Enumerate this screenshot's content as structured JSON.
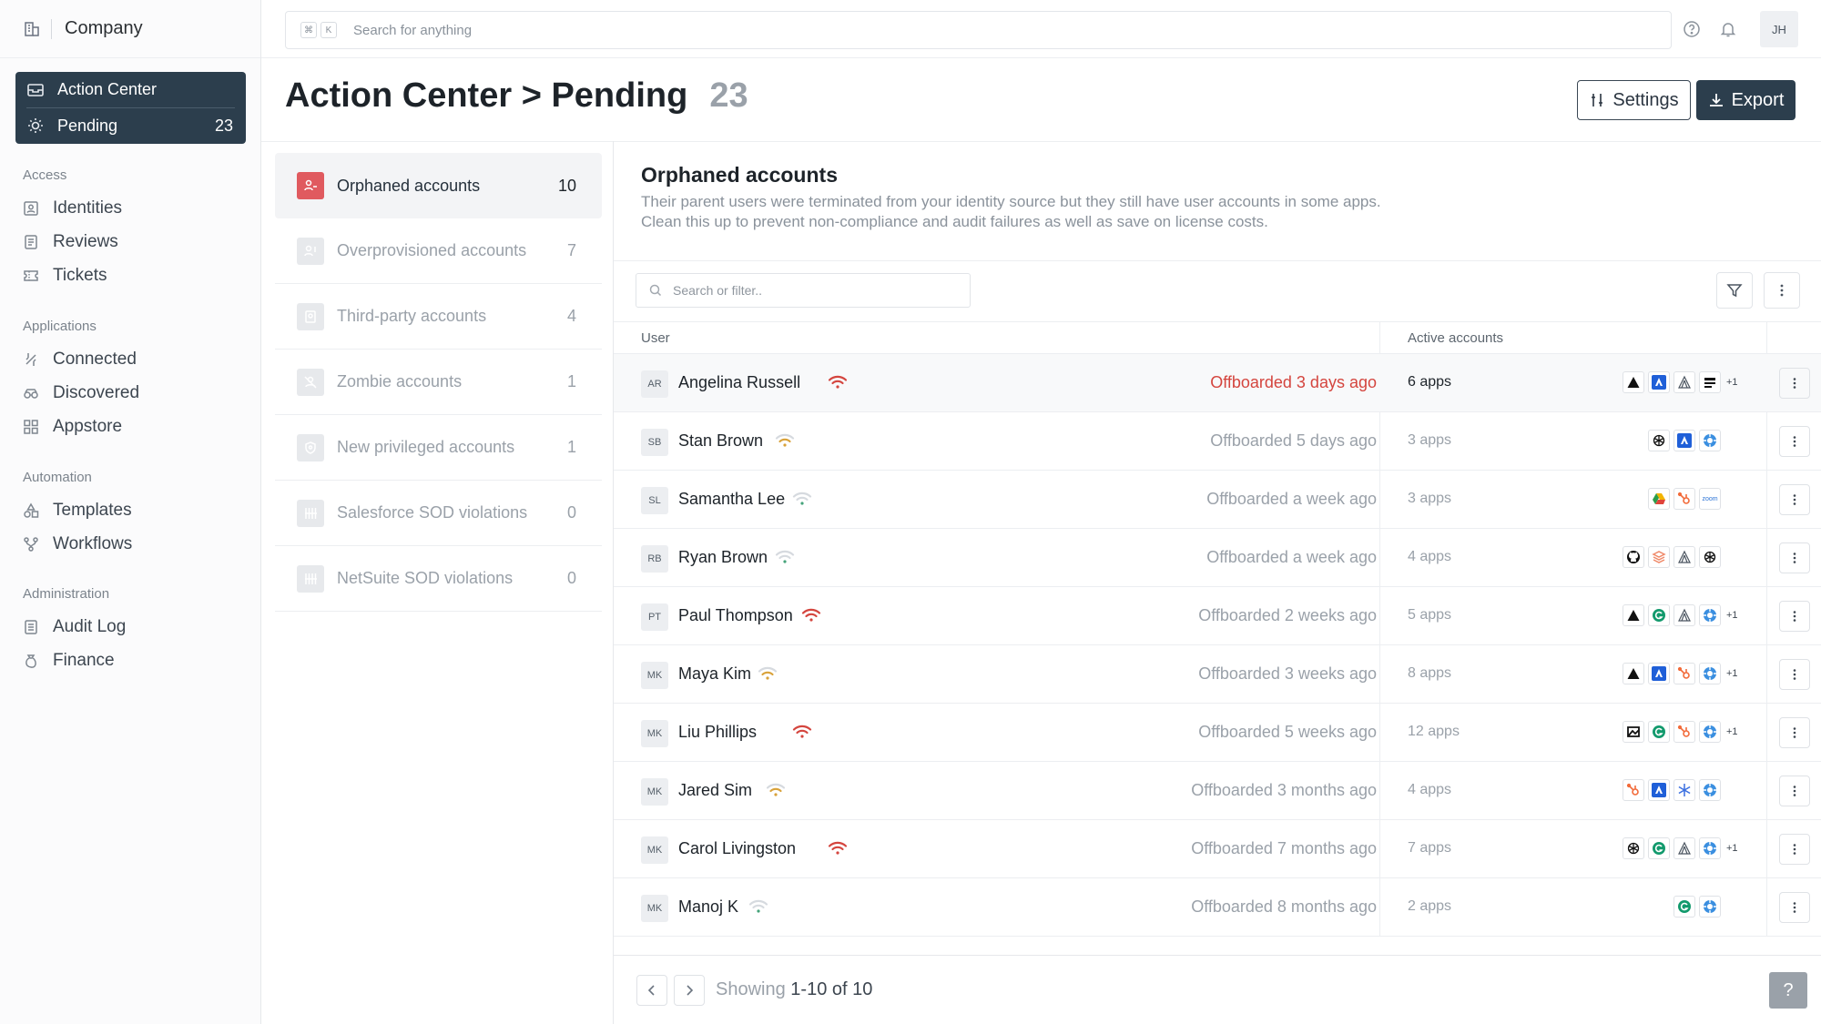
{
  "brand": {
    "name": "Company",
    "icon": "building-icon"
  },
  "action_center": {
    "label": "Action Center",
    "pending_label": "Pending",
    "pending_count": "23"
  },
  "nav": {
    "access": {
      "title": "Access",
      "items": [
        "Identities",
        "Reviews",
        "Tickets"
      ]
    },
    "applications": {
      "title": "Applications",
      "items": [
        "Connected",
        "Discovered",
        "Appstore"
      ]
    },
    "automation": {
      "title": "Automation",
      "items": [
        "Templates",
        "Workflows"
      ]
    },
    "administration": {
      "title": "Administration",
      "items": [
        "Audit Log",
        "Finance"
      ]
    }
  },
  "topbar": {
    "kbd1": "⌘",
    "kbd2": "K",
    "search_placeholder": "Search for anything",
    "avatar": "JH"
  },
  "header": {
    "title": "Action Center > Pending",
    "count": "23",
    "settings_label": "Settings",
    "export_label": "Export"
  },
  "categories": [
    {
      "label": "Orphaned accounts",
      "count": "10",
      "icon": "orphaned-user-icon"
    },
    {
      "label": "Overprovisioned accounts",
      "count": "7",
      "icon": "overprovisioned-user-icon"
    },
    {
      "label": "Third-party accounts",
      "count": "4",
      "icon": "third-party-icon"
    },
    {
      "label": "Zombie accounts",
      "count": "1",
      "icon": "zombie-user-icon"
    },
    {
      "label": "New privileged accounts",
      "count": "1",
      "icon": "shield-icon"
    },
    {
      "label": "Salesforce SOD violations",
      "count": "0",
      "icon": "sod-icon"
    },
    {
      "label": "NetSuite SOD violations",
      "count": "0",
      "icon": "sod-icon"
    }
  ],
  "detail": {
    "title": "Orphaned accounts",
    "description_line1": "Their parent users were terminated from your identity source but they still have user accounts in some apps.",
    "description_line2": "Clean this up to prevent non-compliance and audit failures as well as save on license costs.",
    "filter_placeholder": "Search or filter..",
    "col_user": "User",
    "col_active": "Active accounts"
  },
  "colors": {
    "signal_high": "#d4453e",
    "signal_medium": "#d9a23a",
    "signal_low": "#45a37a",
    "accent": "#2c3e4d"
  },
  "rows": [
    {
      "initials": "AR",
      "name": "Angelina Russell",
      "signal": "high",
      "offboarded": "Offboarded 3 days ago",
      "apps": "6 apps",
      "logos": [
        "vercel-logo",
        "atlassian-logo",
        "confluence-logo",
        "notion-logo"
      ],
      "more": "+1"
    },
    {
      "initials": "SB",
      "name": "Stan Brown",
      "signal": "medium",
      "offboarded": "Offboarded 5 days ago",
      "apps": "3 apps",
      "logos": [
        "openai-logo",
        "atlassian-logo",
        "jira-logo"
      ],
      "more": ""
    },
    {
      "initials": "SL",
      "name": "Samantha Lee",
      "signal": "low",
      "offboarded": "Offboarded a week ago",
      "apps": "3 apps",
      "logos": [
        "google-drive-logo",
        "hubspot-logo",
        "zoom-logo"
      ],
      "more": ""
    },
    {
      "initials": "RB",
      "name": "Ryan Brown",
      "signal": "low",
      "offboarded": "Offboarded a week ago",
      "apps": "4 apps",
      "logos": [
        "github-logo",
        "stack-logo",
        "confluence-logo",
        "openai-logo"
      ],
      "more": ""
    },
    {
      "initials": "PT",
      "name": "Paul Thompson",
      "signal": "high",
      "offboarded": "Offboarded 2 weeks ago",
      "apps": "5 apps",
      "logos": [
        "vercel-logo",
        "grammarly-logo",
        "confluence-logo",
        "jira-logo"
      ],
      "more": "+1"
    },
    {
      "initials": "MK",
      "name": "Maya Kim",
      "signal": "medium",
      "offboarded": "Offboarded 3 weeks ago",
      "apps": "8 apps",
      "logos": [
        "vercel-logo",
        "atlassian-logo",
        "hubspot-logo",
        "jira-logo"
      ],
      "more": "+1"
    },
    {
      "initials": "MK",
      "name": "Liu Phillips",
      "signal": "high",
      "offboarded": "Offboarded 5 weeks ago",
      "apps": "12 apps",
      "logos": [
        "frame-logo",
        "grammarly-logo",
        "hubspot-logo",
        "jira-logo"
      ],
      "more": "+1"
    },
    {
      "initials": "MK",
      "name": "Jared Sim",
      "signal": "medium",
      "offboarded": "Offboarded 3 months ago",
      "apps": "4 apps",
      "logos": [
        "hubspot-logo",
        "atlassian-logo",
        "snowflake-logo",
        "jira-logo"
      ],
      "more": ""
    },
    {
      "initials": "MK",
      "name": "Carol Livingston",
      "signal": "high",
      "offboarded": "Offboarded 7 months ago",
      "apps": "7 apps",
      "logos": [
        "openai-logo",
        "grammarly-logo",
        "confluence-logo",
        "jira-logo"
      ],
      "more": "+1"
    },
    {
      "initials": "MK",
      "name": "Manoj K",
      "signal": "low",
      "offboarded": "Offboarded 8 months ago",
      "apps": "2 apps",
      "logos": [
        "grammarly-logo",
        "jira-logo"
      ],
      "more": ""
    }
  ],
  "pagination": {
    "prefix": "Showing",
    "range": "1-10 of 10"
  },
  "help_label": "?"
}
